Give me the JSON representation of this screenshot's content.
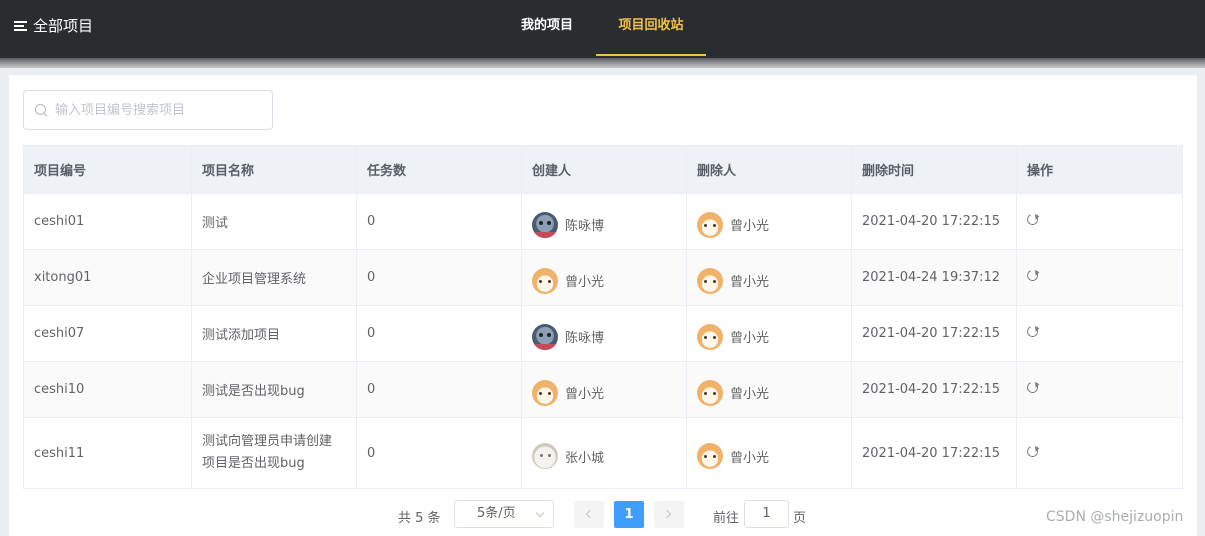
{
  "topbar": {
    "brand_label": "全部项目",
    "tabs": [
      {
        "label": "我的项目",
        "active": false
      },
      {
        "label": "项目回收站",
        "active": true
      }
    ],
    "accent_color": "#f2c14a"
  },
  "search": {
    "placeholder": "输入项目编号搜索项目",
    "value": ""
  },
  "table": {
    "columns": [
      "项目编号",
      "项目名称",
      "任务数",
      "创建人",
      "删除人",
      "删除时间",
      "操作"
    ],
    "rows": [
      {
        "code": "ceshi01",
        "name": "测试",
        "tasks": "0",
        "creator": "陈咏博",
        "creator_avatar": "dark",
        "deleter": "曾小光",
        "deleter_avatar": "cat",
        "deleted_at": "2021-04-20 17:22:15",
        "action_icon": "restore-icon"
      },
      {
        "code": "xitong01",
        "name": "企业项目管理系统",
        "tasks": "0",
        "creator": "曾小光",
        "creator_avatar": "cat",
        "deleter": "曾小光",
        "deleter_avatar": "cat",
        "deleted_at": "2021-04-24 19:37:12",
        "action_icon": "restore-icon"
      },
      {
        "code": "ceshi07",
        "name": "测试添加项目",
        "tasks": "0",
        "creator": "陈咏博",
        "creator_avatar": "dark",
        "deleter": "曾小光",
        "deleter_avatar": "cat",
        "deleted_at": "2021-04-20 17:22:15",
        "action_icon": "restore-icon"
      },
      {
        "code": "ceshi10",
        "name": "测试是否出现bug",
        "tasks": "0",
        "creator": "曾小光",
        "creator_avatar": "cat",
        "deleter": "曾小光",
        "deleter_avatar": "cat",
        "deleted_at": "2021-04-20 17:22:15",
        "action_icon": "restore-icon"
      },
      {
        "code": "ceshi11",
        "name_line1": "测试向管理员申请创建",
        "name_line2": "项目是否出现bug",
        "tasks": "0",
        "creator": "张小城",
        "creator_avatar": "white",
        "deleter": "曾小光",
        "deleter_avatar": "cat",
        "deleted_at": "2021-04-20 17:22:15",
        "action_icon": "restore-icon"
      }
    ]
  },
  "pagination": {
    "total_label": "共 5 条",
    "page_size_label": "5条/页",
    "current_page": "1",
    "goto_prefix": "前往",
    "goto_value": "1",
    "goto_suffix": "页",
    "active_color": "#409eff"
  },
  "watermark": "CSDN @shejizuopin"
}
